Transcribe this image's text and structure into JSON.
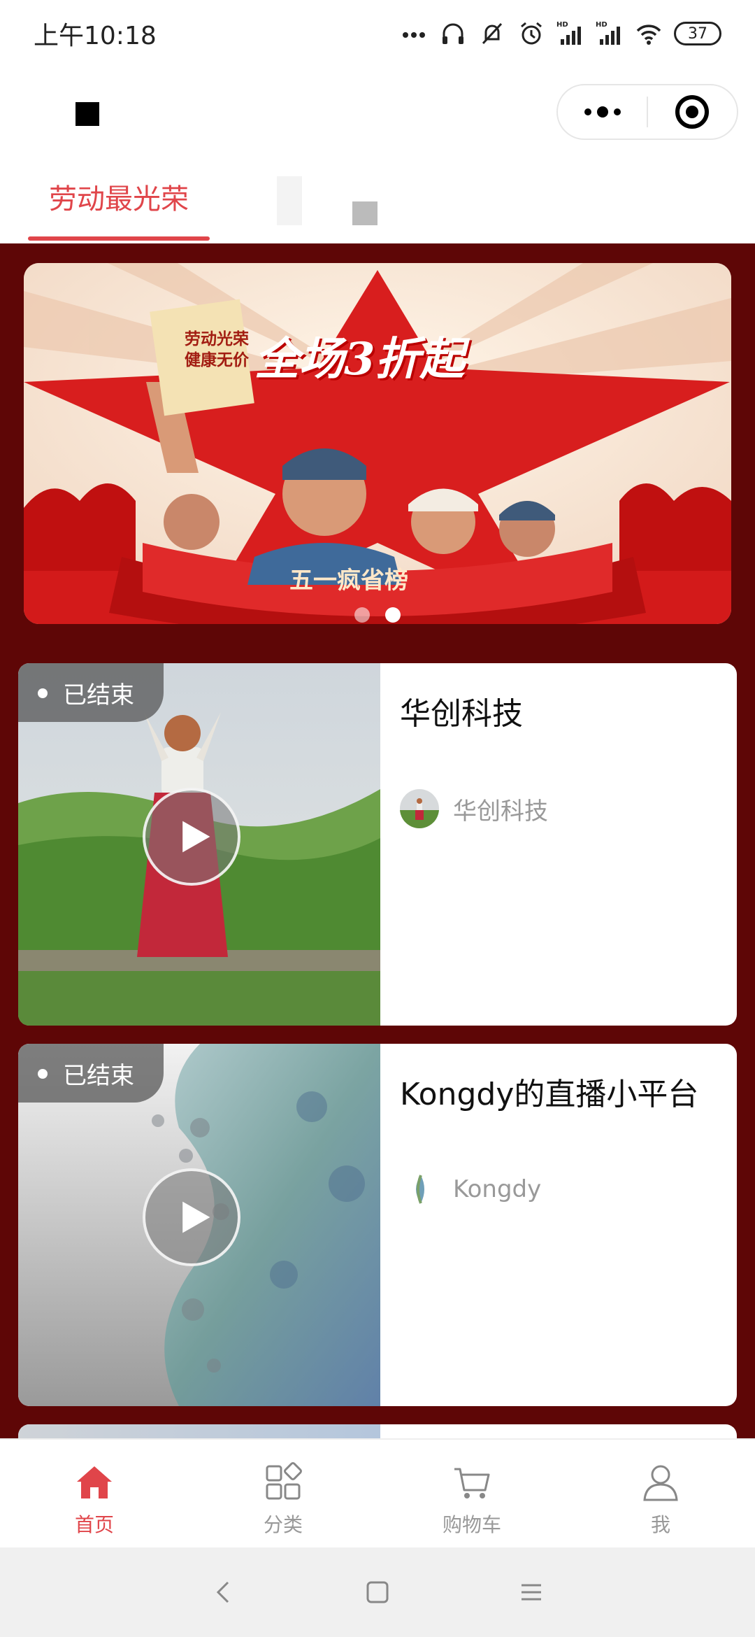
{
  "status_bar": {
    "time": "上午10:18",
    "battery": "37",
    "icons": [
      "more-dots-icon",
      "headset-icon",
      "mute-bell-icon",
      "alarm-icon",
      "signal-hd-icon",
      "signal-hd-icon",
      "wifi-icon",
      "battery-icon"
    ]
  },
  "nav_bar": {
    "more_icon": "more-dots-icon",
    "close_icon": "target-circle-icon"
  },
  "tabs": [
    {
      "label": "劳动最光荣",
      "active": true
    }
  ],
  "banner": {
    "title": "全场3折起",
    "subtitle": "五一疯省榜",
    "book_text": "劳动光荣 健康无价",
    "page_count": 2,
    "active_index": 1
  },
  "live_items": [
    {
      "status": "已结束",
      "title": "华创科技",
      "author": "华创科技"
    },
    {
      "status": "已结束",
      "title": "Kongdy的直播小平台",
      "author": "Kongdy"
    }
  ],
  "tabbar": [
    {
      "label": "首页",
      "icon": "home-icon",
      "active": true
    },
    {
      "label": "分类",
      "icon": "category-grid-icon",
      "active": false
    },
    {
      "label": "购物车",
      "icon": "cart-icon",
      "active": false
    },
    {
      "label": "我",
      "icon": "user-icon",
      "active": false
    }
  ],
  "colors": {
    "accent": "#e0454a",
    "background": "#5e0606",
    "banner_red": "#d81e1e"
  }
}
